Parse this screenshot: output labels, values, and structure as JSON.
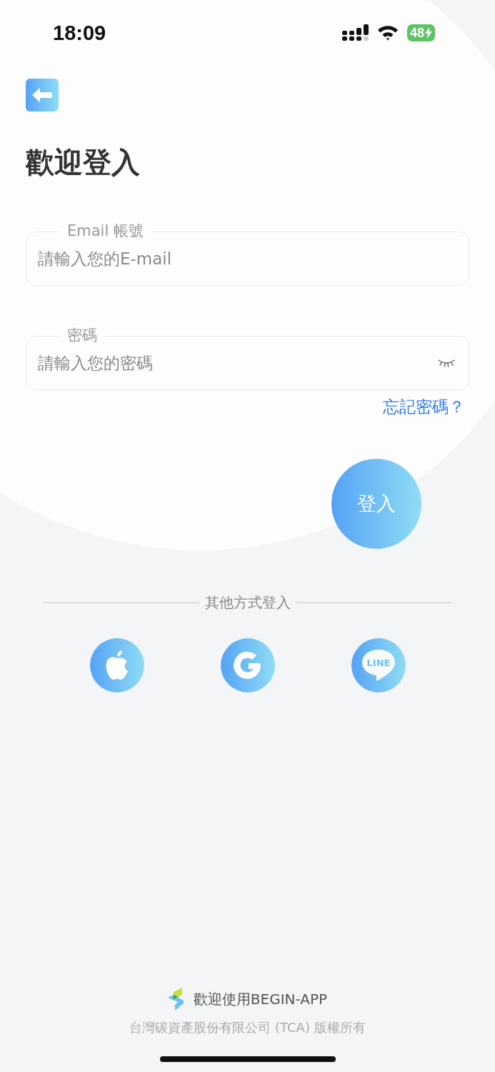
{
  "status_bar": {
    "time": "18:09",
    "battery": "48"
  },
  "title": "歡迎登入",
  "fields": [
    {
      "kind": "email",
      "label": "Email 帳號",
      "placeholder": "請輸入您的E-mail"
    },
    {
      "kind": "password",
      "label": "密碼",
      "placeholder": "請輸入您的密碼"
    }
  ],
  "forgot_link": "忘記密碼？",
  "login_button": "登入",
  "divider_label": "其他方式登入",
  "social_logins": [
    {
      "kind": "apple"
    },
    {
      "kind": "google"
    },
    {
      "kind": "line",
      "label": "LINE"
    }
  ],
  "footer": {
    "brand": "歡迎使用BEGIN-APP",
    "copyright": "台灣碳資產股份有限公司 (TCA) 版權所有"
  }
}
